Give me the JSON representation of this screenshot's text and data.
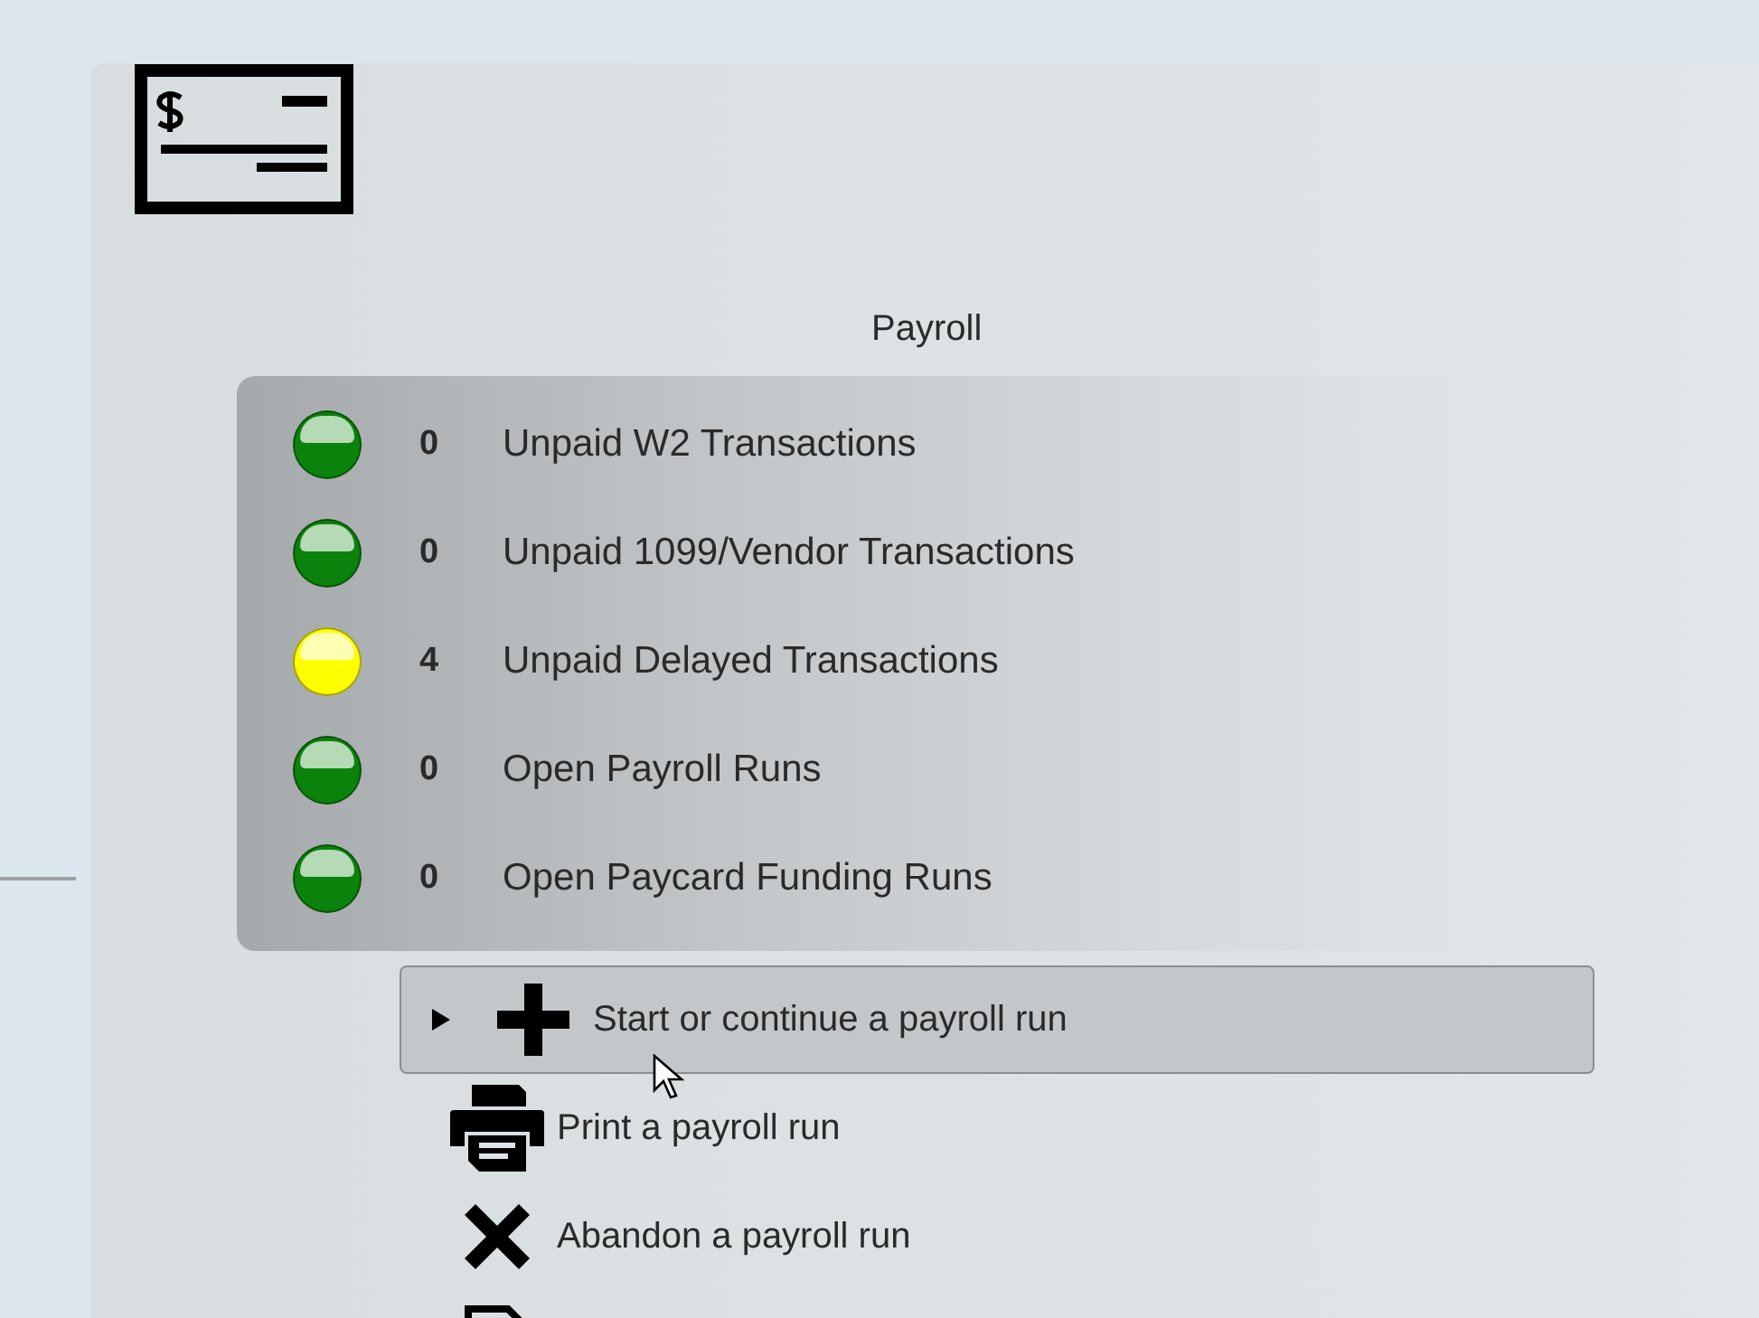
{
  "module": {
    "title": "Payroll"
  },
  "statuses": [
    {
      "color": "#0b820b",
      "count": "0",
      "label": "Unpaid W2 Transactions"
    },
    {
      "color": "#0b820b",
      "count": "0",
      "label": "Unpaid 1099/Vendor Transactions"
    },
    {
      "color": "#ffff00",
      "count": "4",
      "label": "Unpaid Delayed Transactions"
    },
    {
      "color": "#0b820b",
      "count": "0",
      "label": "Open Payroll Runs"
    },
    {
      "color": "#0b820b",
      "count": "0",
      "label": "Open Paycard Funding Runs"
    }
  ],
  "actions": [
    {
      "kind": "plus",
      "label": "Start or continue a payroll run",
      "selected": true
    },
    {
      "kind": "printer",
      "label": "Print a payroll run",
      "selected": false
    },
    {
      "kind": "cross",
      "label": "Abandon a payroll run",
      "selected": false
    },
    {
      "kind": "document",
      "selected": false
    }
  ]
}
